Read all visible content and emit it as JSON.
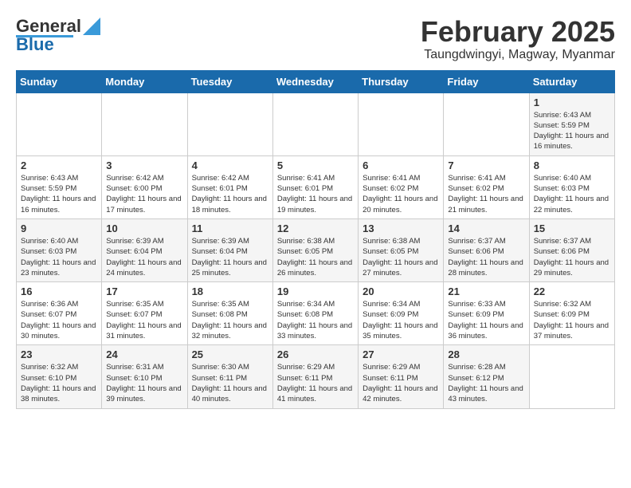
{
  "app": {
    "logo_general": "General",
    "logo_blue": "Blue"
  },
  "title": "February 2025",
  "subtitle": "Taungdwingyi, Magway, Myanmar",
  "weekdays": [
    "Sunday",
    "Monday",
    "Tuesday",
    "Wednesday",
    "Thursday",
    "Friday",
    "Saturday"
  ],
  "weeks": [
    [
      {
        "day": "",
        "info": ""
      },
      {
        "day": "",
        "info": ""
      },
      {
        "day": "",
        "info": ""
      },
      {
        "day": "",
        "info": ""
      },
      {
        "day": "",
        "info": ""
      },
      {
        "day": "",
        "info": ""
      },
      {
        "day": "1",
        "info": "Sunrise: 6:43 AM\nSunset: 5:59 PM\nDaylight: 11 hours and 16 minutes."
      }
    ],
    [
      {
        "day": "2",
        "info": "Sunrise: 6:43 AM\nSunset: 5:59 PM\nDaylight: 11 hours and 16 minutes."
      },
      {
        "day": "3",
        "info": "Sunrise: 6:42 AM\nSunset: 6:00 PM\nDaylight: 11 hours and 17 minutes."
      },
      {
        "day": "4",
        "info": "Sunrise: 6:42 AM\nSunset: 6:01 PM\nDaylight: 11 hours and 18 minutes."
      },
      {
        "day": "5",
        "info": "Sunrise: 6:41 AM\nSunset: 6:01 PM\nDaylight: 11 hours and 19 minutes."
      },
      {
        "day": "6",
        "info": "Sunrise: 6:41 AM\nSunset: 6:02 PM\nDaylight: 11 hours and 20 minutes."
      },
      {
        "day": "7",
        "info": "Sunrise: 6:41 AM\nSunset: 6:02 PM\nDaylight: 11 hours and 21 minutes."
      },
      {
        "day": "8",
        "info": "Sunrise: 6:40 AM\nSunset: 6:03 PM\nDaylight: 11 hours and 22 minutes."
      }
    ],
    [
      {
        "day": "9",
        "info": "Sunrise: 6:40 AM\nSunset: 6:03 PM\nDaylight: 11 hours and 23 minutes."
      },
      {
        "day": "10",
        "info": "Sunrise: 6:39 AM\nSunset: 6:04 PM\nDaylight: 11 hours and 24 minutes."
      },
      {
        "day": "11",
        "info": "Sunrise: 6:39 AM\nSunset: 6:04 PM\nDaylight: 11 hours and 25 minutes."
      },
      {
        "day": "12",
        "info": "Sunrise: 6:38 AM\nSunset: 6:05 PM\nDaylight: 11 hours and 26 minutes."
      },
      {
        "day": "13",
        "info": "Sunrise: 6:38 AM\nSunset: 6:05 PM\nDaylight: 11 hours and 27 minutes."
      },
      {
        "day": "14",
        "info": "Sunrise: 6:37 AM\nSunset: 6:06 PM\nDaylight: 11 hours and 28 minutes."
      },
      {
        "day": "15",
        "info": "Sunrise: 6:37 AM\nSunset: 6:06 PM\nDaylight: 11 hours and 29 minutes."
      }
    ],
    [
      {
        "day": "16",
        "info": "Sunrise: 6:36 AM\nSunset: 6:07 PM\nDaylight: 11 hours and 30 minutes."
      },
      {
        "day": "17",
        "info": "Sunrise: 6:35 AM\nSunset: 6:07 PM\nDaylight: 11 hours and 31 minutes."
      },
      {
        "day": "18",
        "info": "Sunrise: 6:35 AM\nSunset: 6:08 PM\nDaylight: 11 hours and 32 minutes."
      },
      {
        "day": "19",
        "info": "Sunrise: 6:34 AM\nSunset: 6:08 PM\nDaylight: 11 hours and 33 minutes."
      },
      {
        "day": "20",
        "info": "Sunrise: 6:34 AM\nSunset: 6:09 PM\nDaylight: 11 hours and 35 minutes."
      },
      {
        "day": "21",
        "info": "Sunrise: 6:33 AM\nSunset: 6:09 PM\nDaylight: 11 hours and 36 minutes."
      },
      {
        "day": "22",
        "info": "Sunrise: 6:32 AM\nSunset: 6:09 PM\nDaylight: 11 hours and 37 minutes."
      }
    ],
    [
      {
        "day": "23",
        "info": "Sunrise: 6:32 AM\nSunset: 6:10 PM\nDaylight: 11 hours and 38 minutes."
      },
      {
        "day": "24",
        "info": "Sunrise: 6:31 AM\nSunset: 6:10 PM\nDaylight: 11 hours and 39 minutes."
      },
      {
        "day": "25",
        "info": "Sunrise: 6:30 AM\nSunset: 6:11 PM\nDaylight: 11 hours and 40 minutes."
      },
      {
        "day": "26",
        "info": "Sunrise: 6:29 AM\nSunset: 6:11 PM\nDaylight: 11 hours and 41 minutes."
      },
      {
        "day": "27",
        "info": "Sunrise: 6:29 AM\nSunset: 6:11 PM\nDaylight: 11 hours and 42 minutes."
      },
      {
        "day": "28",
        "info": "Sunrise: 6:28 AM\nSunset: 6:12 PM\nDaylight: 11 hours and 43 minutes."
      },
      {
        "day": "",
        "info": ""
      }
    ]
  ]
}
